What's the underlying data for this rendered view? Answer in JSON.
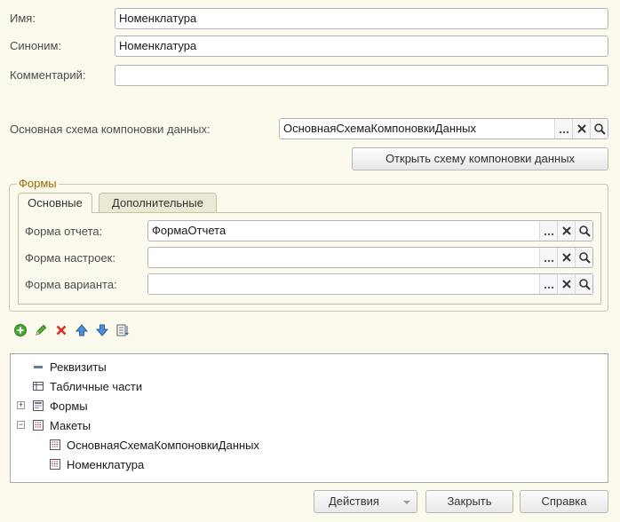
{
  "props": {
    "name_label": "Имя:",
    "name_value": "Номенклатура",
    "synonym_label": "Синоним:",
    "synonym_value": "Номенклатура",
    "comment_label": "Комментарий:",
    "comment_value": "",
    "schema_label": "Основная схема компоновки данных:",
    "schema_value": "ОсновнаяСхемаКомпоновкиДанных",
    "open_schema_button": "Открыть схему компоновки данных"
  },
  "forms_group": {
    "title": "Формы",
    "tabs": [
      {
        "label": "Основные",
        "active": true
      },
      {
        "label": "Дополнительные",
        "active": false
      }
    ],
    "fields": [
      {
        "label": "Форма отчета:",
        "value": "ФормаОтчета"
      },
      {
        "label": "Форма настроек:",
        "value": ""
      },
      {
        "label": "Форма варианта:",
        "value": ""
      }
    ],
    "field_buttons": [
      "...",
      "x",
      "search"
    ]
  },
  "toolbar": {
    "icons": [
      "add-icon",
      "edit-icon",
      "delete-icon",
      "move-up-icon",
      "move-down-icon",
      "sort-list-icon"
    ]
  },
  "tree": {
    "items": [
      {
        "label": "Реквизиты",
        "level": 0,
        "icon": "attribute-icon",
        "expander": ""
      },
      {
        "label": "Табличные части",
        "level": 0,
        "icon": "table-icon",
        "expander": ""
      },
      {
        "label": "Формы",
        "level": 0,
        "icon": "form-icon",
        "expander": "+"
      },
      {
        "label": "Макеты",
        "level": 0,
        "icon": "layout-icon",
        "expander": "−"
      },
      {
        "label": "ОсновнаяСхемаКомпоновкиДанных",
        "level": 1,
        "icon": "layout-icon",
        "expander": ""
      },
      {
        "label": "Номенклатура",
        "level": 1,
        "icon": "layout-icon",
        "expander": ""
      }
    ]
  },
  "footer": {
    "actions_button": "Действия",
    "close_button": "Закрыть",
    "help_button": "Справка"
  },
  "colors": {
    "background": "#fbfaed",
    "group_title": "#9b6b00",
    "field_border": "#b4b4b4"
  }
}
